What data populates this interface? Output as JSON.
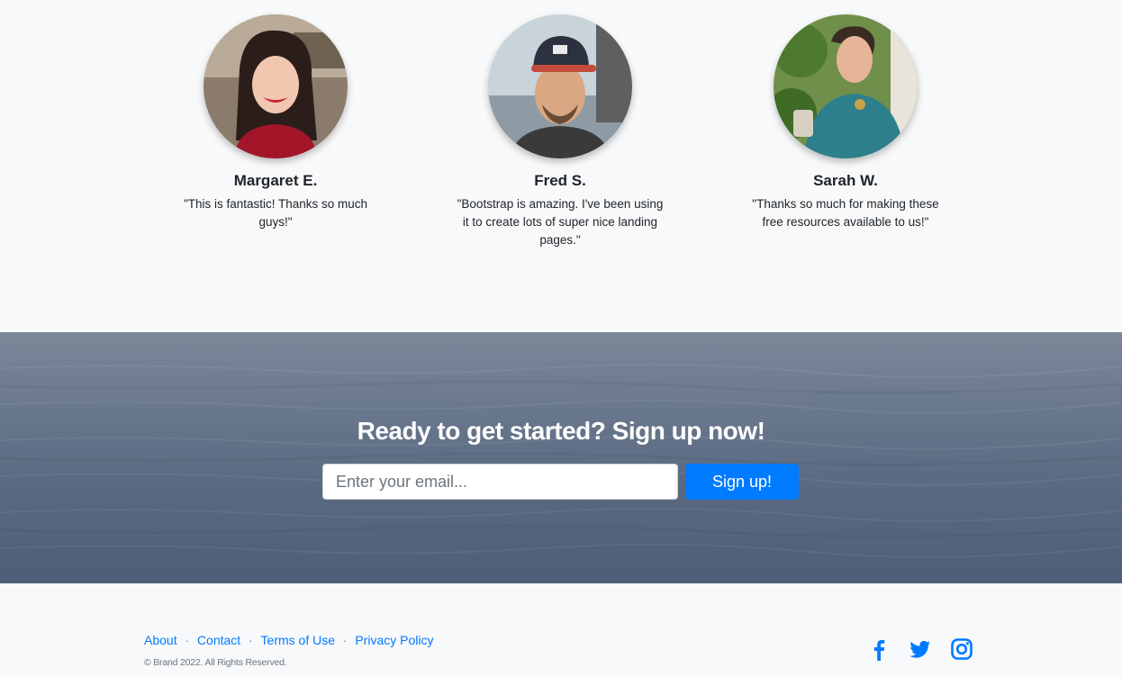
{
  "testimonials": [
    {
      "name": "Margaret E.",
      "quote": "\"This is fantastic! Thanks so much guys!\""
    },
    {
      "name": "Fred S.",
      "quote": "\"Bootstrap is amazing. I've been using it to create lots of super nice landing pages.\""
    },
    {
      "name": "Sarah W.",
      "quote": "\"Thanks so much for making these free resources available to us!\""
    }
  ],
  "cta": {
    "title": "Ready to get started? Sign up now!",
    "email_placeholder": "Enter your email...",
    "signup_label": "Sign up!"
  },
  "footer": {
    "links": [
      "About",
      "Contact",
      "Terms of Use",
      "Privacy Policy"
    ],
    "separator": "·",
    "copyright": "© Brand 2022. All Rights Reserved.",
    "social": [
      "facebook-icon",
      "twitter-icon",
      "instagram-icon"
    ]
  },
  "colors": {
    "accent": "#007bff",
    "background": "#f8f9fa",
    "text": "#212529",
    "muted": "#6c757d"
  }
}
